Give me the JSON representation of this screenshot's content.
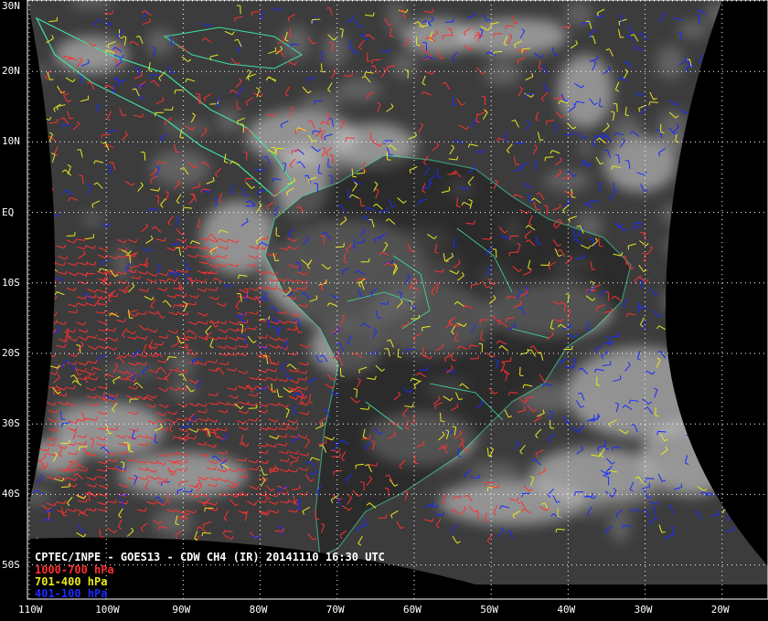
{
  "title": "CPTEC/INPE - GOES13 - CDW CH4 (IR) 20141110 16:30 UTC",
  "legend": [
    {
      "label": "1000-700 hPa",
      "color": "#ff3030"
    },
    {
      "label": "701-400 hPa",
      "color": "#e8e820"
    },
    {
      "label": "401-100 hPa",
      "color": "#1a2aff"
    }
  ],
  "lat_labels": [
    "30N",
    "20N",
    "10N",
    "EQ",
    "10S",
    "20S",
    "30S",
    "40S",
    "50S"
  ],
  "lon_labels": [
    "110W",
    "100W",
    "90W",
    "80W",
    "70W",
    "60W",
    "50W",
    "40W",
    "30W",
    "20W"
  ],
  "colors": {
    "coast": "#40e0a0",
    "grid": "#ffffff",
    "space": "#000000",
    "earth": "#3a3a3a"
  }
}
